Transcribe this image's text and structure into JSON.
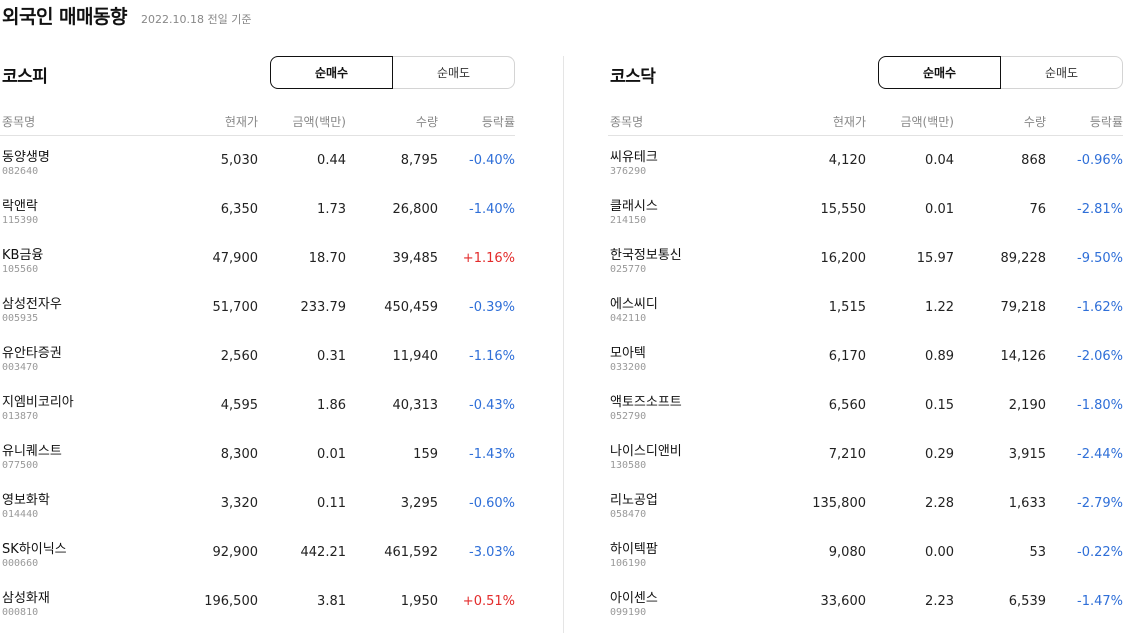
{
  "header": {
    "title": "외국인 매매동향",
    "date_note": "2022.10.18 전일 기준"
  },
  "columns": {
    "name": "종목명",
    "price": "현재가",
    "amount": "금액(백만)",
    "qty": "수량",
    "rate": "등락률"
  },
  "kospi": {
    "name": "코스피",
    "tabs": [
      "순매수",
      "순매도"
    ],
    "active_tab": "순매수",
    "rows": [
      {
        "name": "동양생명",
        "code": "082640",
        "price": "5,030",
        "amount": "0.44",
        "qty": "8,795",
        "rate": "-0.40%",
        "dir": "down"
      },
      {
        "name": "락앤락",
        "code": "115390",
        "price": "6,350",
        "amount": "1.73",
        "qty": "26,800",
        "rate": "-1.40%",
        "dir": "down"
      },
      {
        "name": "KB금융",
        "code": "105560",
        "price": "47,900",
        "amount": "18.70",
        "qty": "39,485",
        "rate": "+1.16%",
        "dir": "up"
      },
      {
        "name": "삼성전자우",
        "code": "005935",
        "price": "51,700",
        "amount": "233.79",
        "qty": "450,459",
        "rate": "-0.39%",
        "dir": "down"
      },
      {
        "name": "유안타증권",
        "code": "003470",
        "price": "2,560",
        "amount": "0.31",
        "qty": "11,940",
        "rate": "-1.16%",
        "dir": "down"
      },
      {
        "name": "지엠비코리아",
        "code": "013870",
        "price": "4,595",
        "amount": "1.86",
        "qty": "40,313",
        "rate": "-0.43%",
        "dir": "down"
      },
      {
        "name": "유니퀘스트",
        "code": "077500",
        "price": "8,300",
        "amount": "0.01",
        "qty": "159",
        "rate": "-1.43%",
        "dir": "down"
      },
      {
        "name": "영보화학",
        "code": "014440",
        "price": "3,320",
        "amount": "0.11",
        "qty": "3,295",
        "rate": "-0.60%",
        "dir": "down"
      },
      {
        "name": "SK하이닉스",
        "code": "000660",
        "price": "92,900",
        "amount": "442.21",
        "qty": "461,592",
        "rate": "-3.03%",
        "dir": "down"
      },
      {
        "name": "삼성화재",
        "code": "000810",
        "price": "196,500",
        "amount": "3.81",
        "qty": "1,950",
        "rate": "+0.51%",
        "dir": "up"
      }
    ]
  },
  "kosdaq": {
    "name": "코스닥",
    "tabs": [
      "순매수",
      "순매도"
    ],
    "active_tab": "순매수",
    "rows": [
      {
        "name": "씨유테크",
        "code": "376290",
        "price": "4,120",
        "amount": "0.04",
        "qty": "868",
        "rate": "-0.96%",
        "dir": "down"
      },
      {
        "name": "클래시스",
        "code": "214150",
        "price": "15,550",
        "amount": "0.01",
        "qty": "76",
        "rate": "-2.81%",
        "dir": "down"
      },
      {
        "name": "한국정보통신",
        "code": "025770",
        "price": "16,200",
        "amount": "15.97",
        "qty": "89,228",
        "rate": "-9.50%",
        "dir": "down"
      },
      {
        "name": "에스씨디",
        "code": "042110",
        "price": "1,515",
        "amount": "1.22",
        "qty": "79,218",
        "rate": "-1.62%",
        "dir": "down"
      },
      {
        "name": "모아텍",
        "code": "033200",
        "price": "6,170",
        "amount": "0.89",
        "qty": "14,126",
        "rate": "-2.06%",
        "dir": "down"
      },
      {
        "name": "액토즈소프트",
        "code": "052790",
        "price": "6,560",
        "amount": "0.15",
        "qty": "2,190",
        "rate": "-1.80%",
        "dir": "down"
      },
      {
        "name": "나이스디앤비",
        "code": "130580",
        "price": "7,210",
        "amount": "0.29",
        "qty": "3,915",
        "rate": "-2.44%",
        "dir": "down"
      },
      {
        "name": "리노공업",
        "code": "058470",
        "price": "135,800",
        "amount": "2.28",
        "qty": "1,633",
        "rate": "-2.79%",
        "dir": "down"
      },
      {
        "name": "하이텍팜",
        "code": "106190",
        "price": "9,080",
        "amount": "0.00",
        "qty": "53",
        "rate": "-0.22%",
        "dir": "down"
      },
      {
        "name": "아이센스",
        "code": "099190",
        "price": "33,600",
        "amount": "2.23",
        "qty": "6,539",
        "rate": "-1.47%",
        "dir": "down"
      }
    ]
  }
}
